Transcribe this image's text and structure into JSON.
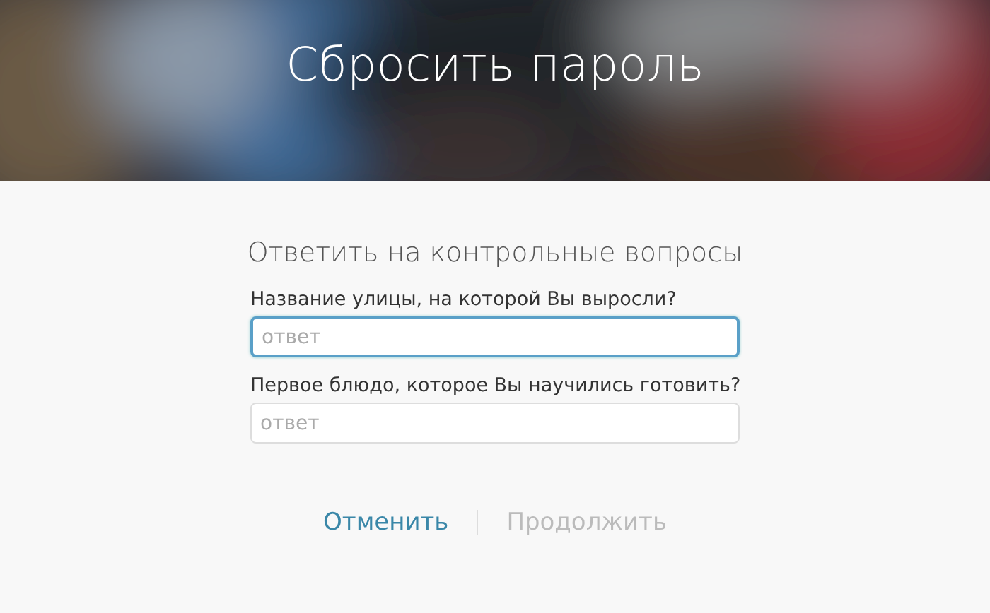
{
  "header": {
    "title": "Сбросить пароль"
  },
  "subtitle": "Ответить на контрольные вопросы",
  "questions": [
    {
      "label": "Название улицы, на которой Вы выросли?",
      "placeholder": "ответ",
      "focused": true
    },
    {
      "label": "Первое блюдо, которое Вы научились готовить?",
      "placeholder": "ответ",
      "focused": false
    }
  ],
  "buttons": [
    {
      "label": "Отменить",
      "disabled": false
    },
    {
      "label": "Продолжить",
      "disabled": true
    }
  ]
}
